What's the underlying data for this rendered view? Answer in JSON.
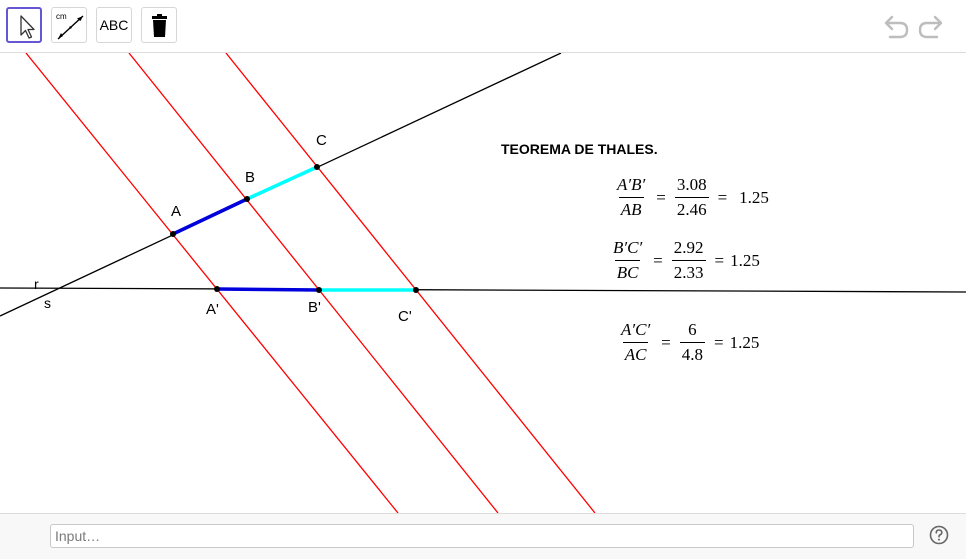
{
  "toolbar": {
    "tools": [
      {
        "name": "move",
        "icon": "cursor-arrow-icon"
      },
      {
        "name": "distance",
        "icon": "distance-ruler-icon",
        "unit_label": "cm"
      },
      {
        "name": "text",
        "label": "ABC"
      },
      {
        "name": "delete",
        "icon": "trash-icon"
      }
    ],
    "undo_icon": "undo-icon",
    "redo_icon": "redo-icon"
  },
  "canvas": {
    "title": "TEOREMA DE THALES.",
    "points": {
      "A": "A",
      "B": "B",
      "C": "C",
      "A1": "A'",
      "B1": "B'",
      "C1": "C'",
      "r": "r",
      "s": "s"
    },
    "colors": {
      "parallel_lines": "#ff0000",
      "segment_AB": "#0000dd",
      "segment_BC": "#00ffff",
      "lines": "#000000"
    },
    "ratios": [
      {
        "num": "A′B′",
        "den": "AB",
        "value_num": "3.08",
        "value_den": "2.46",
        "result": "1.25"
      },
      {
        "num": "B′C′",
        "den": "BC",
        "value_num": "2.92",
        "value_den": "2.33",
        "result": "1.25"
      },
      {
        "num": "A′C′",
        "den": "AC",
        "value_num": "6",
        "value_den": "4.8",
        "result": "1.25"
      }
    ],
    "equals": "="
  },
  "input_bar": {
    "placeholder": "Input…",
    "help_icon": "help-icon"
  }
}
